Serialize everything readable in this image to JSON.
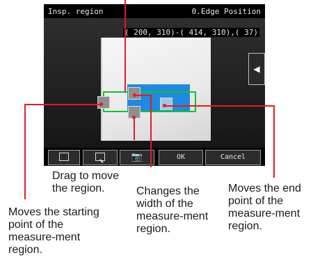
{
  "screen": {
    "title_left": "Insp. region",
    "title_right": "0.Edge Position",
    "coordinates": "( 200, 310)-( 414, 310),( 37)"
  },
  "buttons": {
    "fit_icon": "frame-icon",
    "zoom_icon": "zoom-icon",
    "camera_icon": "camera-icon",
    "ok_label": "OK",
    "cancel_label": "Cancel"
  },
  "annotations": {
    "drag": "Drag to move the region.",
    "width": "Changes the width of the measure-ment region.",
    "end": "Moves the end point of the measure-ment region.",
    "start": "Moves the starting point of the measure-ment region."
  },
  "colors": {
    "region_border": "#17c127",
    "annotation_line": "#e31b23",
    "highlight": "#1f8ae0"
  }
}
